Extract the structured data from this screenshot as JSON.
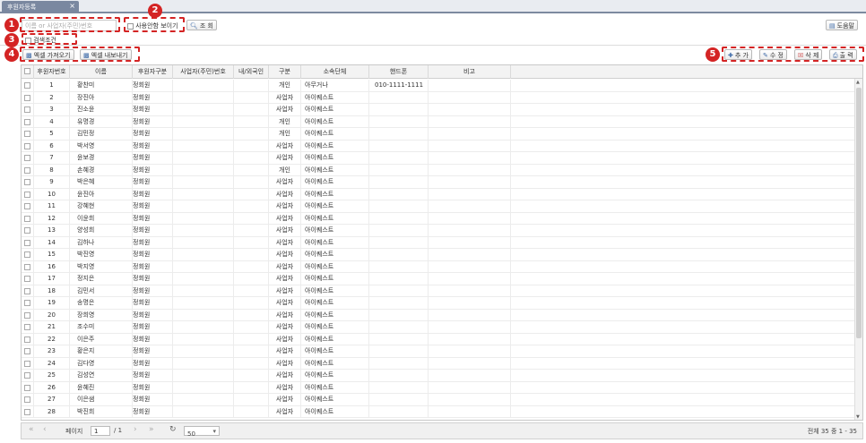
{
  "tab": {
    "title": "후원자등록",
    "close": "×"
  },
  "search": {
    "placeholder": "이름 or 사업자(주민)번호"
  },
  "toolbar": {
    "show_unused": "사용안함 보이기",
    "query_label": "조 회",
    "help_label": "도움말",
    "search_condition": "검색조건",
    "excel_import": "엑셀 가져오기",
    "excel_export": "엑셀 내보내기",
    "add_label": "추 가",
    "edit_label": "수 정",
    "delete_label": "삭 제",
    "print_label": "출 력"
  },
  "markers": [
    "1",
    "2",
    "3",
    "4",
    "5"
  ],
  "columns": [
    "후원자번호",
    "이름",
    "후원자구분",
    "사업자(주민)번호",
    "내/외국인",
    "구분",
    "소속단체",
    "핸드폰",
    "비고"
  ],
  "rows": [
    [
      "1",
      "황찬미",
      "정회원",
      "",
      "",
      "개인",
      "아무거나",
      "010-1111-1111",
      ""
    ],
    [
      "2",
      "장진아",
      "정회원",
      "",
      "",
      "사업자",
      "아이퀘스트",
      "",
      ""
    ],
    [
      "3",
      "진소윤",
      "정회원",
      "",
      "",
      "사업자",
      "아이퀘스트",
      "",
      ""
    ],
    [
      "4",
      "유명경",
      "정회원",
      "",
      "",
      "개인",
      "아이퀘스트",
      "",
      ""
    ],
    [
      "5",
      "김민정",
      "정회원",
      "",
      "",
      "개인",
      "아이퀘스트",
      "",
      ""
    ],
    [
      "6",
      "박서영",
      "정회원",
      "",
      "",
      "사업자",
      "아이퀘스트",
      "",
      ""
    ],
    [
      "7",
      "윤보경",
      "정회원",
      "",
      "",
      "사업자",
      "아이퀘스트",
      "",
      ""
    ],
    [
      "8",
      "손혜경",
      "정회원",
      "",
      "",
      "개인",
      "아이퀘스트",
      "",
      ""
    ],
    [
      "9",
      "박은혜",
      "정회원",
      "",
      "",
      "사업자",
      "아이퀘스트",
      "",
      ""
    ],
    [
      "10",
      "윤진아",
      "정회원",
      "",
      "",
      "사업자",
      "아이퀘스트",
      "",
      ""
    ],
    [
      "11",
      "강혜현",
      "정회원",
      "",
      "",
      "사업자",
      "아이퀘스트",
      "",
      ""
    ],
    [
      "12",
      "이윤희",
      "정회원",
      "",
      "",
      "사업자",
      "아이퀘스트",
      "",
      ""
    ],
    [
      "13",
      "양성희",
      "정회원",
      "",
      "",
      "사업자",
      "아이퀘스트",
      "",
      ""
    ],
    [
      "14",
      "김하나",
      "정회원",
      "",
      "",
      "사업자",
      "아이퀘스트",
      "",
      ""
    ],
    [
      "15",
      "박진영",
      "정회원",
      "",
      "",
      "사업자",
      "아이퀘스트",
      "",
      ""
    ],
    [
      "16",
      "박지영",
      "정회원",
      "",
      "",
      "사업자",
      "아이퀘스트",
      "",
      ""
    ],
    [
      "17",
      "정지은",
      "정회원",
      "",
      "",
      "사업자",
      "아이퀘스트",
      "",
      ""
    ],
    [
      "18",
      "김민서",
      "정회원",
      "",
      "",
      "사업자",
      "아이퀘스트",
      "",
      ""
    ],
    [
      "19",
      "송명은",
      "정회원",
      "",
      "",
      "사업자",
      "아이퀘스트",
      "",
      ""
    ],
    [
      "20",
      "장희영",
      "정회원",
      "",
      "",
      "사업자",
      "아이퀘스트",
      "",
      ""
    ],
    [
      "21",
      "조수미",
      "정회원",
      "",
      "",
      "사업자",
      "아이퀘스트",
      "",
      ""
    ],
    [
      "22",
      "이은주",
      "정회원",
      "",
      "",
      "사업자",
      "아이퀘스트",
      "",
      ""
    ],
    [
      "23",
      "황은지",
      "정회원",
      "",
      "",
      "사업자",
      "아이퀘스트",
      "",
      ""
    ],
    [
      "24",
      "김다영",
      "정회원",
      "",
      "",
      "사업자",
      "아이퀘스트",
      "",
      ""
    ],
    [
      "25",
      "김성연",
      "정회원",
      "",
      "",
      "사업자",
      "아이퀘스트",
      "",
      ""
    ],
    [
      "26",
      "윤혜진",
      "정회원",
      "",
      "",
      "사업자",
      "아이퀘스트",
      "",
      ""
    ],
    [
      "27",
      "이은샘",
      "정회원",
      "",
      "",
      "사업자",
      "아이퀘스트",
      "",
      ""
    ],
    [
      "28",
      "박진희",
      "정회원",
      "",
      "",
      "사업자",
      "아이퀘스트",
      "",
      ""
    ]
  ],
  "pager": {
    "page_label": "페이지",
    "page_value": "1",
    "total_pages": "/ 1",
    "page_size": "50",
    "summary": "전체 35 중 1 - 35"
  }
}
